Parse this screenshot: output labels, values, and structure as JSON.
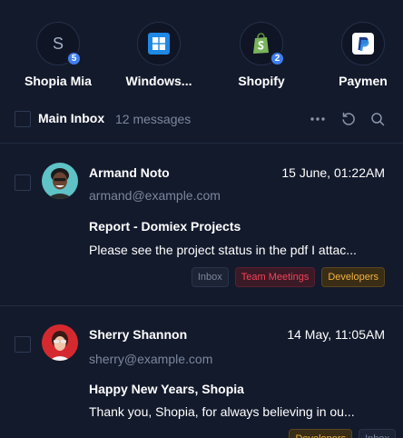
{
  "accounts": [
    {
      "name": "Shopia Mia",
      "icon": "letter-s-avatar-icon",
      "letter": "S",
      "badge": "5"
    },
    {
      "name": "Windows...",
      "icon": "windows-logo-icon",
      "badge": ""
    },
    {
      "name": "Shopify",
      "icon": "shopify-logo-icon",
      "badge": "2"
    },
    {
      "name": "Paymen",
      "icon": "paypal-logo-icon",
      "badge": ""
    }
  ],
  "inbox": {
    "title": "Main Inbox",
    "count": "12 messages",
    "icons": [
      "more-dots-icon",
      "refresh-icon",
      "search-icon"
    ]
  },
  "messages": [
    {
      "sender": "Armand Noto",
      "date": "15 June, 01:22AM",
      "email": "armand@example.com",
      "subject": "Report - Domiex Projects",
      "preview": "Please see the project status in the pdf I attac...",
      "tags": [
        "Inbox",
        "Team Meetings",
        "Developers"
      ]
    },
    {
      "sender": "Sherry Shannon",
      "date": "14 May, 11:05AM",
      "email": "sherry@example.com",
      "subject": "Happy New Years, Shopia",
      "preview": "Thank you, Shopia, for always believing in ou...",
      "tags": [
        "Developers",
        "Inbox"
      ]
    }
  ],
  "colors": {
    "background": "#131a2c",
    "accent_badge": "#3f7ff0",
    "tag_team": "#f0435a",
    "tag_dev": "#f3b33e",
    "muted_text": "#7b879e"
  }
}
